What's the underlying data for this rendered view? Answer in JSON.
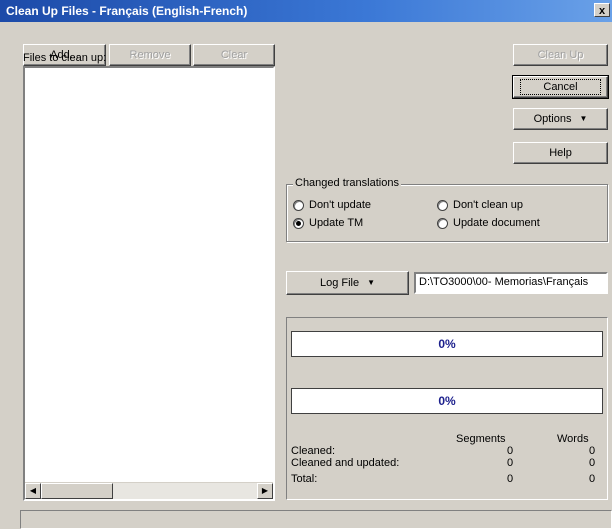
{
  "window": {
    "title": "Clean Up Files - Français  (English-French)",
    "close_glyph": "x"
  },
  "file_buttons": {
    "add": "Add...",
    "remove": "Remove",
    "clear": "Clear"
  },
  "files_label": "Files to clean up:",
  "action_buttons": {
    "clean_up": "Clean Up",
    "cancel": "Cancel",
    "options": "Options",
    "help": "Help"
  },
  "changed_translations": {
    "title": "Changed translations",
    "options": [
      {
        "label": "Don't update",
        "selected": false
      },
      {
        "label": "Don't clean up",
        "selected": false
      },
      {
        "label": "Update TM",
        "selected": true
      },
      {
        "label": "Update document",
        "selected": false
      }
    ]
  },
  "log_file": {
    "button": "Log File",
    "path": "D:\\TO3000\\00- Memorias\\Français"
  },
  "progress": {
    "bar1": "0%",
    "bar2": "0%",
    "bar1_value": 0,
    "bar2_value": 0
  },
  "stats": {
    "headers": {
      "segments": "Segments",
      "words": "Words"
    },
    "rows": [
      {
        "label": "Cleaned:",
        "segments": "0",
        "words": "0"
      },
      {
        "label": "Cleaned and updated:",
        "segments": "0",
        "words": "0"
      },
      {
        "label": "Total:",
        "segments": "0",
        "words": "0"
      }
    ]
  },
  "icons": {
    "dropdown": "triangle-down",
    "scroll_left": "triangle-left",
    "scroll_right": "triangle-right"
  }
}
